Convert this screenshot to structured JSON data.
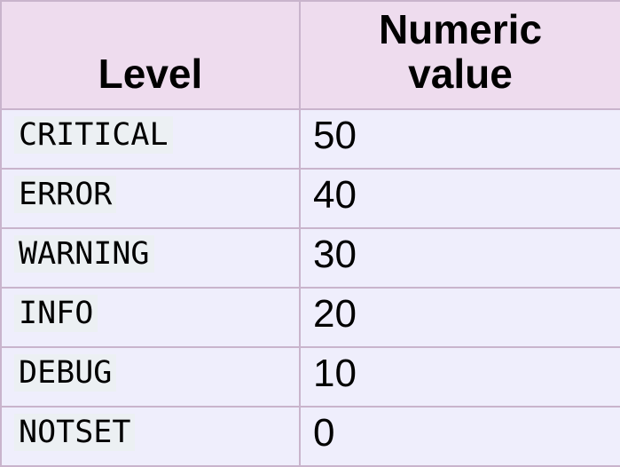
{
  "table": {
    "headers": {
      "level": "Level",
      "value_line1": "Numeric",
      "value_line2": "value"
    },
    "rows": [
      {
        "level": "CRITICAL",
        "value": "50"
      },
      {
        "level": "ERROR",
        "value": "40"
      },
      {
        "level": "WARNING",
        "value": "30"
      },
      {
        "level": "INFO",
        "value": "20"
      },
      {
        "level": "DEBUG",
        "value": "10"
      },
      {
        "level": "NOTSET",
        "value": "0"
      }
    ]
  },
  "colors": {
    "header_background": "#eedcee",
    "cell_background": "#efeefc",
    "border": "#c9b4cc",
    "code_background": "#ecf0f3"
  }
}
